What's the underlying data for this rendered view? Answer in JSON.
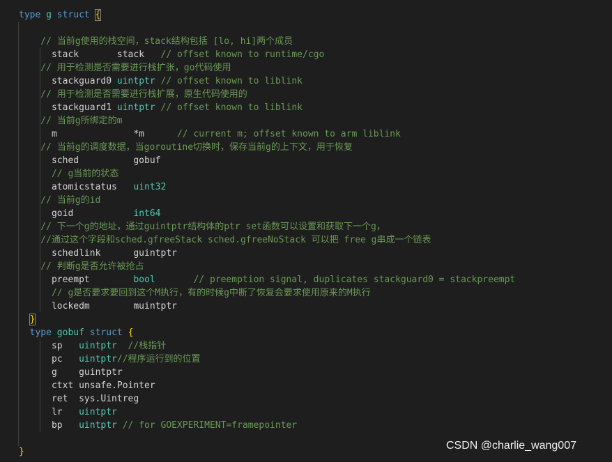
{
  "editor": {
    "colors": {
      "background": "#1e1e1e",
      "keyword": "#569cd6",
      "type": "#4ec9b0",
      "comment": "#6a9955",
      "plain": "#d4d4d4",
      "bracket": "#ffd700"
    },
    "lines": [
      [
        [
          "type",
          "k"
        ],
        [
          " ",
          "p"
        ],
        [
          "g",
          "t"
        ],
        [
          " ",
          "p"
        ],
        [
          "struct",
          "k"
        ],
        [
          " ",
          "p"
        ],
        [
          "{",
          "b"
        ]
      ],
      [],
      [
        [
          "    // 当前g使用的栈空间，stack结构包括 [lo, hi]两个成员",
          "c"
        ]
      ],
      [
        [
          "      stack       ",
          "p"
        ],
        [
          "stack",
          "p"
        ],
        [
          "   // offset known to runtime/cgo",
          "c"
        ]
      ],
      [
        [
          "    // 用于检测是否需要进行栈扩张，go代码使用",
          "c"
        ]
      ],
      [
        [
          "      stackguard0 ",
          "p"
        ],
        [
          "uintptr",
          "t"
        ],
        [
          " // offset known to liblink",
          "c"
        ]
      ],
      [
        [
          "    // 用于检测是否需要进行栈扩展，原生代码使用的",
          "c"
        ]
      ],
      [
        [
          "      stackguard1 ",
          "p"
        ],
        [
          "uintptr",
          "t"
        ],
        [
          " // offset known to liblink",
          "c"
        ]
      ],
      [
        [
          "    // 当前g所绑定的m",
          "c"
        ]
      ],
      [
        [
          "      m              *m      ",
          "p"
        ],
        [
          "// current m; offset known to arm liblink",
          "c"
        ]
      ],
      [
        [
          "    // 当前g的调度数据，当goroutine切换时，保存当前g的上下文，用于恢复",
          "c"
        ]
      ],
      [
        [
          "      sched          gobuf",
          "p"
        ]
      ],
      [
        [
          "      // g当前的状态",
          "c"
        ]
      ],
      [
        [
          "      atomicstatus   ",
          "p"
        ],
        [
          "uint32",
          "t"
        ]
      ],
      [
        [
          "    // 当前g的id",
          "c"
        ]
      ],
      [
        [
          "      goid           ",
          "p"
        ],
        [
          "int64",
          "t"
        ]
      ],
      [
        [
          "    // 下一个g的地址，通过guintptr结构体的ptr set函数可以设置和获取下一个g，",
          "c"
        ]
      ],
      [
        [
          "    //通过这个字段和sched.gfreeStack sched.gfreeNoStack 可以把 free g串成一个链表",
          "c"
        ]
      ],
      [
        [
          "      schedlink      guintptr",
          "p"
        ]
      ],
      [
        [
          "    // 判断g是否允许被抢占",
          "c"
        ]
      ],
      [
        [
          "      preempt        ",
          "p"
        ],
        [
          "bool",
          "t"
        ],
        [
          "       // preemption signal, duplicates stackguard0 = stackpreempt",
          "c"
        ]
      ],
      [
        [
          "      // g是否要求要回到这个M执行，有的时候g中断了恢复会要求使用原来的M执行",
          "c"
        ]
      ],
      [
        [
          "      lockedm        muintptr",
          "p"
        ]
      ],
      [
        [
          "  ",
          "p"
        ],
        [
          "}",
          "b"
        ]
      ],
      [
        [
          "  ",
          "p"
        ],
        [
          "type",
          "k"
        ],
        [
          " ",
          "p"
        ],
        [
          "gobuf",
          "t"
        ],
        [
          " ",
          "p"
        ],
        [
          "struct",
          "k"
        ],
        [
          " ",
          "p"
        ],
        [
          "{",
          "b2"
        ]
      ],
      [
        [
          "      sp   ",
          "p"
        ],
        [
          "uintptr",
          "t"
        ],
        [
          "  //栈指针",
          "c"
        ]
      ],
      [
        [
          "      pc   ",
          "p"
        ],
        [
          "uintptr",
          "t"
        ],
        [
          "//程序运行到的位置",
          "c"
        ]
      ],
      [
        [
          "      g    guintptr",
          "p"
        ]
      ],
      [
        [
          "      ctxt unsafe.Pointer",
          "p"
        ]
      ],
      [
        [
          "      ret  sys.Uintreg",
          "p"
        ]
      ],
      [
        [
          "      lr   ",
          "p"
        ],
        [
          "uintptr",
          "t"
        ]
      ],
      [
        [
          "      bp   ",
          "p"
        ],
        [
          "uintptr",
          "t"
        ],
        [
          " // for GOEXPERIMENT=framepointer",
          "c"
        ]
      ],
      [],
      [
        [
          "}",
          "b2"
        ]
      ]
    ]
  },
  "watermark": "CSDN @charlie_wang007"
}
